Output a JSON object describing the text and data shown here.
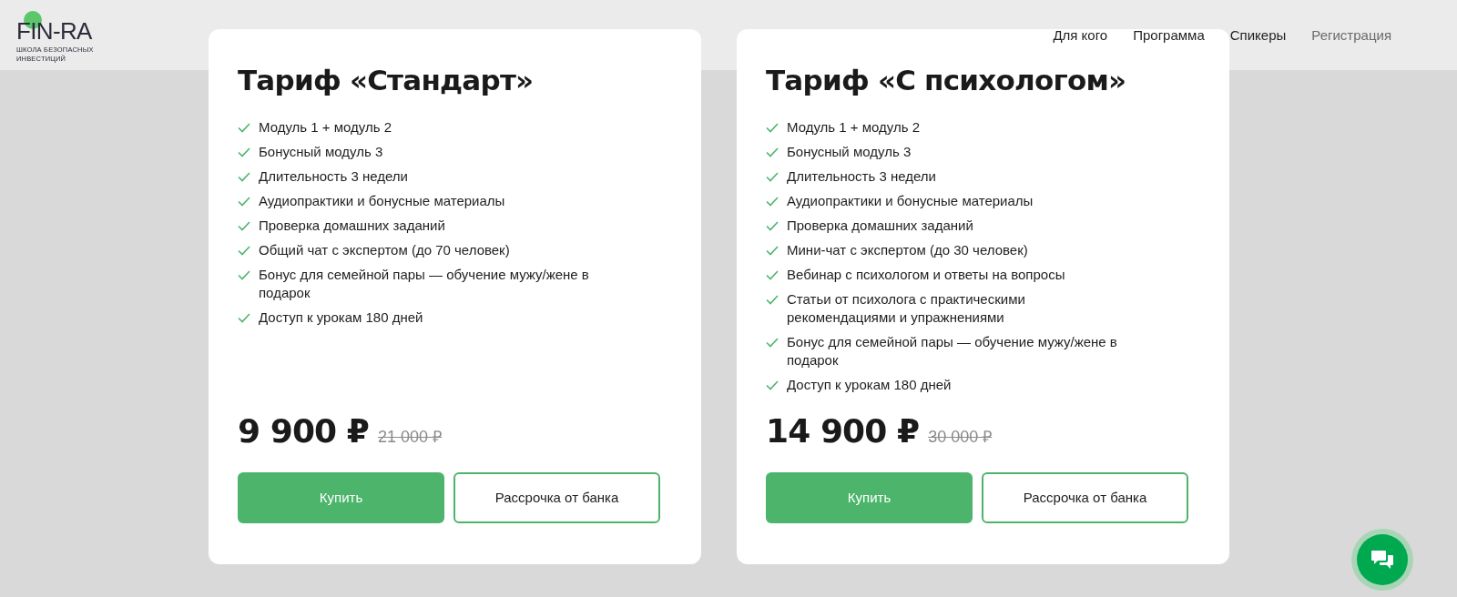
{
  "logo": {
    "wordmark": "FIN-RA",
    "tagline": "ШКОЛА БЕЗОПАСНЫХ ИНВЕСТИЦИЙ"
  },
  "nav": [
    {
      "label": "Для кого",
      "selected": false
    },
    {
      "label": "Программа",
      "selected": false
    },
    {
      "label": "Спикеры",
      "selected": false
    },
    {
      "label": "Регистрация",
      "selected": true
    }
  ],
  "tariffs": [
    {
      "title": "Тариф «Стандарт»",
      "features": [
        "Модуль 1 + модуль 2",
        "Бонусный модуль 3",
        "Длительность 3 недели",
        "Аудиопрактики и бонусные материалы",
        "Проверка домашних заданий",
        "Общий чат с экспертом (до 70 человек)",
        "Бонус для семейной пары — обучение мужу/жене в подарок",
        "Доступ к урокам 180 дней"
      ],
      "price": "9 900 ₽",
      "old_price": "21 000 ₽",
      "buy_button": "Купить",
      "installment_button": "Рассрочка от банка"
    },
    {
      "title": "Тариф «С психологом»",
      "features": [
        "Модуль 1 + модуль 2",
        "Бонусный модуль 3",
        "Длительность 3 недели",
        "Аудиопрактики и бонусные материалы",
        "Проверка домашних заданий",
        "Мини-чат с экспертом (до 30 человек)",
        "Вебинар с психологом и ответы на вопросы",
        "Статьи от психолога с практическими рекомендациями и упражнениями",
        "Бонус для семейной пары — обучение мужу/жене в подарок",
        "Доступ к урокам 180 дней"
      ],
      "price": "14 900 ₽",
      "old_price": "30 000 ₽",
      "buy_button": "Купить",
      "installment_button": "Рассрочка от банка"
    }
  ]
}
